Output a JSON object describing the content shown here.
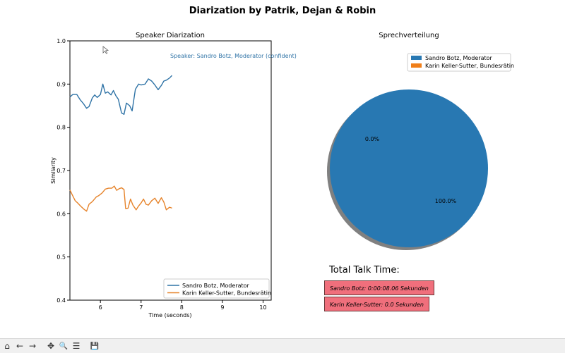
{
  "figure": {
    "suptitle": "Diarization by Patrik, Dejan & Robin",
    "line_chart_title": "Speaker Diarization",
    "pie_chart_title": "Sprechverteilung"
  },
  "chart_data": [
    {
      "type": "line",
      "title": "Speaker Diarization",
      "xlabel": "Time (seconds)",
      "ylabel": "Similarity",
      "xlim": [
        5.25,
        10.2
      ],
      "ylim": [
        0.4,
        1.0
      ],
      "x_ticks": [
        "6",
        "7",
        "8",
        "9",
        "10"
      ],
      "y_ticks": [
        "0.4",
        "0.5",
        "0.6",
        "0.7",
        "0.8",
        "0.9",
        "1.0"
      ],
      "annotation": "Speaker: Sandro Botz, Moderator (confident)",
      "legend_position": "lower-right",
      "series": [
        {
          "name": "Sandro Botz, Moderator",
          "color": "#2f73a6",
          "x": [
            5.25,
            5.32,
            5.42,
            5.5,
            5.58,
            5.66,
            5.72,
            5.8,
            5.86,
            5.92,
            6.0,
            6.06,
            6.12,
            6.18,
            6.26,
            6.32,
            6.38,
            6.44,
            6.52,
            6.58,
            6.64,
            6.72,
            6.78,
            6.86,
            6.94,
            7.0,
            7.1,
            7.18,
            7.26,
            7.34,
            7.42,
            7.5,
            7.56,
            7.62,
            7.7,
            7.76
          ],
          "y": [
            0.87,
            0.876,
            0.876,
            0.864,
            0.855,
            0.844,
            0.848,
            0.868,
            0.875,
            0.869,
            0.876,
            0.9,
            0.879,
            0.882,
            0.875,
            0.885,
            0.873,
            0.865,
            0.833,
            0.83,
            0.856,
            0.85,
            0.838,
            0.888,
            0.9,
            0.898,
            0.9,
            0.912,
            0.907,
            0.898,
            0.887,
            0.897,
            0.907,
            0.909,
            0.914,
            0.92
          ]
        },
        {
          "name": "Karin Keller-Sutter, Bundesrätin",
          "color": "#e6832a",
          "x": [
            5.25,
            5.3,
            5.38,
            5.44,
            5.52,
            5.6,
            5.66,
            5.72,
            5.8,
            5.9,
            5.96,
            6.04,
            6.12,
            6.2,
            6.28,
            6.34,
            6.4,
            6.46,
            6.52,
            6.58,
            6.62,
            6.68,
            6.74,
            6.8,
            6.88,
            6.94,
            7.0,
            7.06,
            7.12,
            7.18,
            7.26,
            7.34,
            7.42,
            7.5,
            7.56,
            7.62,
            7.7,
            7.76
          ],
          "y": [
            0.655,
            0.645,
            0.63,
            0.625,
            0.617,
            0.61,
            0.606,
            0.622,
            0.628,
            0.639,
            0.642,
            0.648,
            0.657,
            0.659,
            0.659,
            0.664,
            0.654,
            0.658,
            0.66,
            0.656,
            0.612,
            0.613,
            0.634,
            0.62,
            0.609,
            0.618,
            0.625,
            0.634,
            0.622,
            0.62,
            0.63,
            0.636,
            0.624,
            0.637,
            0.627,
            0.609,
            0.615,
            0.613
          ]
        }
      ]
    },
    {
      "type": "pie",
      "title": "Sprechverteilung",
      "shadow": true,
      "legend_position": "upper-right",
      "slices": [
        {
          "label": "Sandro Botz, Moderator",
          "value": 100.0,
          "pct_label": "100.0%",
          "color": "#2878b2"
        },
        {
          "label": "Karin Keller-Sutter, Bundesrätin",
          "value": 0.0,
          "pct_label": "0.0%",
          "color": "#f07f1a"
        }
      ]
    }
  ],
  "talk_time": {
    "title": "Total Talk Time:",
    "entries": [
      "Sandro Botz: 0:00:08.06 Sekunden",
      "Karin Keller-Sutter: 0.0 Sekunden"
    ]
  },
  "toolbar": {
    "buttons": [
      {
        "name": "home-icon",
        "glyph": "⌂"
      },
      {
        "name": "back-icon",
        "glyph": "←"
      },
      {
        "name": "forward-icon",
        "glyph": "→"
      },
      {
        "name": "pan-icon",
        "glyph": "✥"
      },
      {
        "name": "zoom-icon",
        "glyph": "🔍"
      },
      {
        "name": "configure-subplots-icon",
        "glyph": "☰"
      },
      {
        "name": "save-icon",
        "glyph": "💾"
      }
    ]
  }
}
